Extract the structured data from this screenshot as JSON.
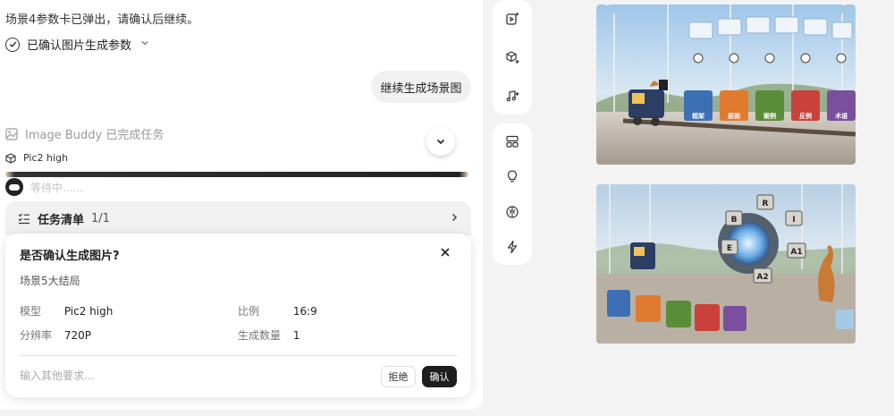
{
  "chat": {
    "intro_text": "场景4参数卡已弹出，请确认后继续。",
    "confirm_params_label": "已确认图片生成参数",
    "user_message": "继续生成场景图",
    "task_done_text": "Image Buddy 已完成任务",
    "model_name": "Pic2 high",
    "waiting_text": "等待中......"
  },
  "task_list": {
    "title": "任务清单",
    "count": "1/1"
  },
  "dialog": {
    "title": "是否确认生成图片?",
    "scene": "场景5大结局",
    "fields": {
      "model_label": "模型",
      "model_value": "Pic2 high",
      "ratio_label": "比例",
      "ratio_value": "16:9",
      "resolution_label": "分辨率",
      "resolution_value": "720P",
      "count_label": "生成数量",
      "count_value": "1"
    },
    "input_placeholder": "输入其他要求...",
    "reject_label": "拒绝",
    "confirm_label": "确认"
  },
  "canvas": {
    "image1_tags": [
      "框架",
      "原则",
      "案例",
      "反例",
      "术语"
    ],
    "image2_letters": [
      "R",
      "B",
      "I",
      "E",
      "A1",
      "A2"
    ]
  },
  "tools": [
    "video-add-icon",
    "cube-add-icon",
    "music-add-icon",
    "layout-icon",
    "lightbulb-icon",
    "brain-icon",
    "lightning-icon"
  ]
}
